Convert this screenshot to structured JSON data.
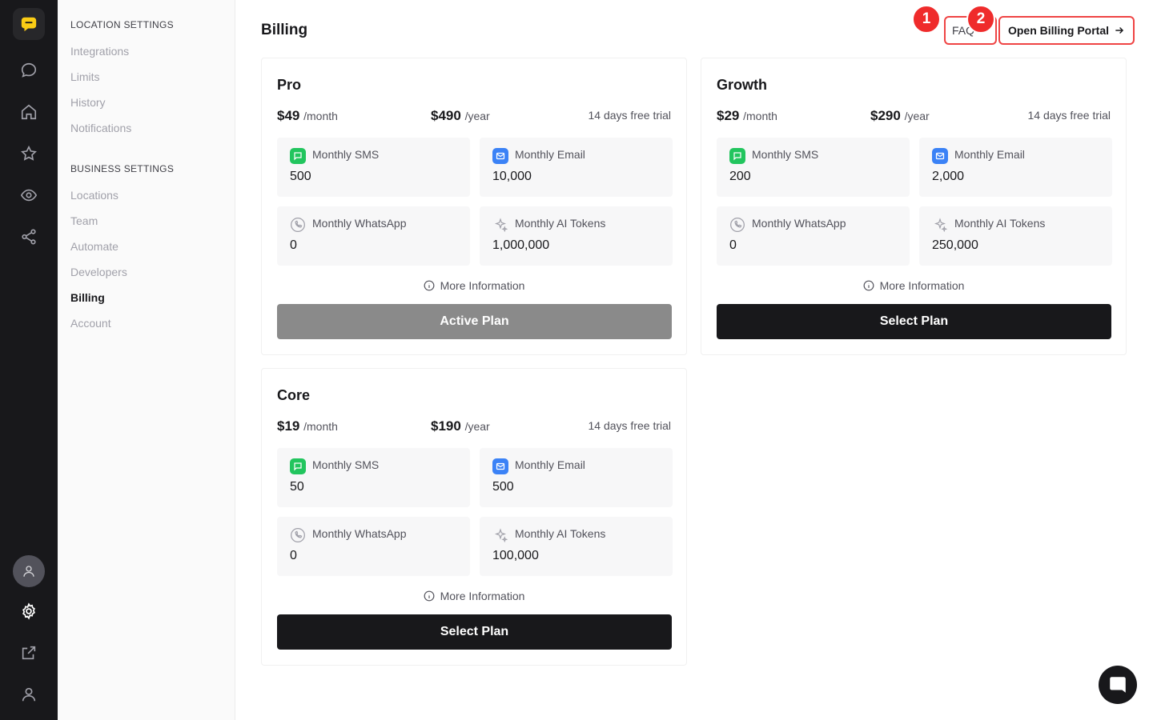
{
  "nav": {
    "location_heading": "LOCATION SETTINGS",
    "location_items": [
      "Integrations",
      "Limits",
      "History",
      "Notifications"
    ],
    "business_heading": "BUSINESS SETTINGS",
    "business_items": [
      "Locations",
      "Team",
      "Automate",
      "Developers",
      "Billing",
      "Account"
    ],
    "active_item": "Billing"
  },
  "header": {
    "title": "Billing",
    "faq_label": "FAQ",
    "portal_label": "Open Billing Portal",
    "badge_1": "1",
    "badge_2": "2"
  },
  "labels": {
    "per_month": "/month",
    "per_year": "/year",
    "sms": "Monthly SMS",
    "email": "Monthly Email",
    "whatsapp": "Monthly WhatsApp",
    "ai_tokens": "Monthly AI Tokens",
    "more_info": "More Information"
  },
  "plans": [
    {
      "name": "Pro",
      "monthly_price": "$49",
      "yearly_price": "$490",
      "trial": "14 days free trial",
      "sms": "500",
      "email": "10,000",
      "whatsapp": "0",
      "ai_tokens": "1,000,000",
      "button": "Active Plan"
    },
    {
      "name": "Growth",
      "monthly_price": "$29",
      "yearly_price": "$290",
      "trial": "14 days free trial",
      "sms": "200",
      "email": "2,000",
      "whatsapp": "0",
      "ai_tokens": "250,000",
      "button": "Select Plan"
    },
    {
      "name": "Core",
      "monthly_price": "$19",
      "yearly_price": "$190",
      "trial": "14 days free trial",
      "sms": "50",
      "email": "500",
      "whatsapp": "0",
      "ai_tokens": "100,000",
      "button": "Select Plan"
    }
  ],
  "colors": {
    "sms_icon": "#22c55e",
    "email_icon": "#3b82f6",
    "annotation": "#ef4444",
    "rail": "#18181b",
    "logo_accent": "#facc15"
  },
  "icons": {
    "rail": [
      "logo-icon",
      "chat-icon",
      "home-icon",
      "star-icon",
      "eye-icon",
      "share-icon",
      "avatar-icon",
      "gear-icon",
      "external-link-icon",
      "user-icon"
    ]
  }
}
